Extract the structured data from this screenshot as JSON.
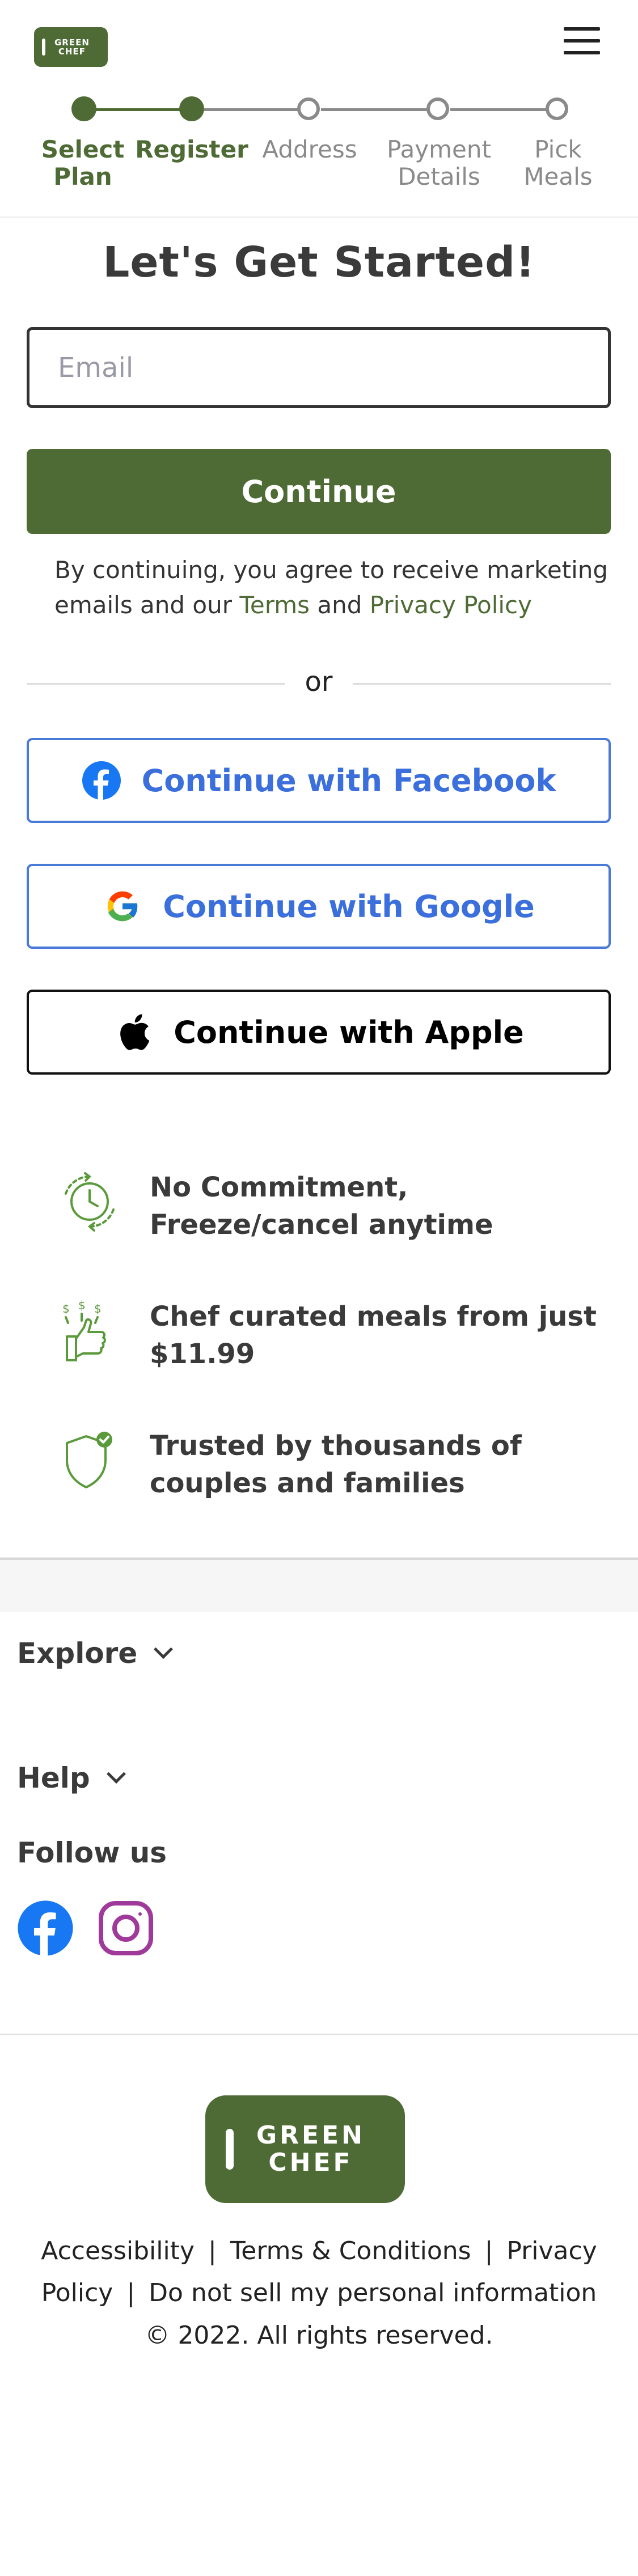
{
  "header": {
    "logo_text": "GREEN CHEF",
    "logo_line1": "GREEN",
    "logo_line2": "CHEF",
    "menu_icon": "hamburger-menu-icon"
  },
  "stepper": {
    "steps": [
      {
        "line1": "Select",
        "line2": "Plan",
        "state": "done"
      },
      {
        "line1": "Register",
        "line2": "",
        "state": "done"
      },
      {
        "line1": "Address",
        "line2": "",
        "state": "todo"
      },
      {
        "line1": "Payment",
        "line2": "Details",
        "state": "todo"
      },
      {
        "line1": "Pick",
        "line2": "Meals",
        "state": "todo"
      }
    ]
  },
  "main": {
    "title": "Let's Get Started!",
    "email_placeholder": "Email",
    "email_value": "",
    "continue_label": "Continue",
    "consent_prefix": "By continuing, you agree to receive marketing emails and our ",
    "terms_label": "Terms",
    "consent_and": " and ",
    "privacy_label": "Privacy Policy",
    "or_label": "or",
    "facebook_label": "Continue with Facebook",
    "google_label": "Continue with Google",
    "apple_label": "Continue with Apple"
  },
  "benefits": [
    {
      "icon": "clock-cycle-icon",
      "line1": "No Commitment,",
      "line2": "Freeze/cancel anytime"
    },
    {
      "icon": "thumbs-up-money-icon",
      "line1": "Chef curated meals from just",
      "line2": "$11.99"
    },
    {
      "icon": "shield-check-icon",
      "line1": "Trusted by thousands of",
      "line2": "couples and families"
    }
  ],
  "footer": {
    "explore_label": "Explore",
    "help_label": "Help",
    "follow_label": "Follow us",
    "social": [
      "facebook-icon",
      "instagram-icon"
    ],
    "logo_line1": "GREEN",
    "logo_line2": "CHEF",
    "accessibility": "Accessibility",
    "terms_conditions": "Terms & Conditions",
    "privacy_policy": "Privacy Policy",
    "do_not_sell": "Do not sell my personal information",
    "separator": "|",
    "copyright": "© 2022. All rights reserved."
  },
  "colors": {
    "brand_green": "#4f6b35",
    "link_blue": "#3b6fdc",
    "inactive_gray": "#8a8a8a",
    "instagram_purple": "#a03a9a",
    "facebook_blue": "#1877f2"
  }
}
